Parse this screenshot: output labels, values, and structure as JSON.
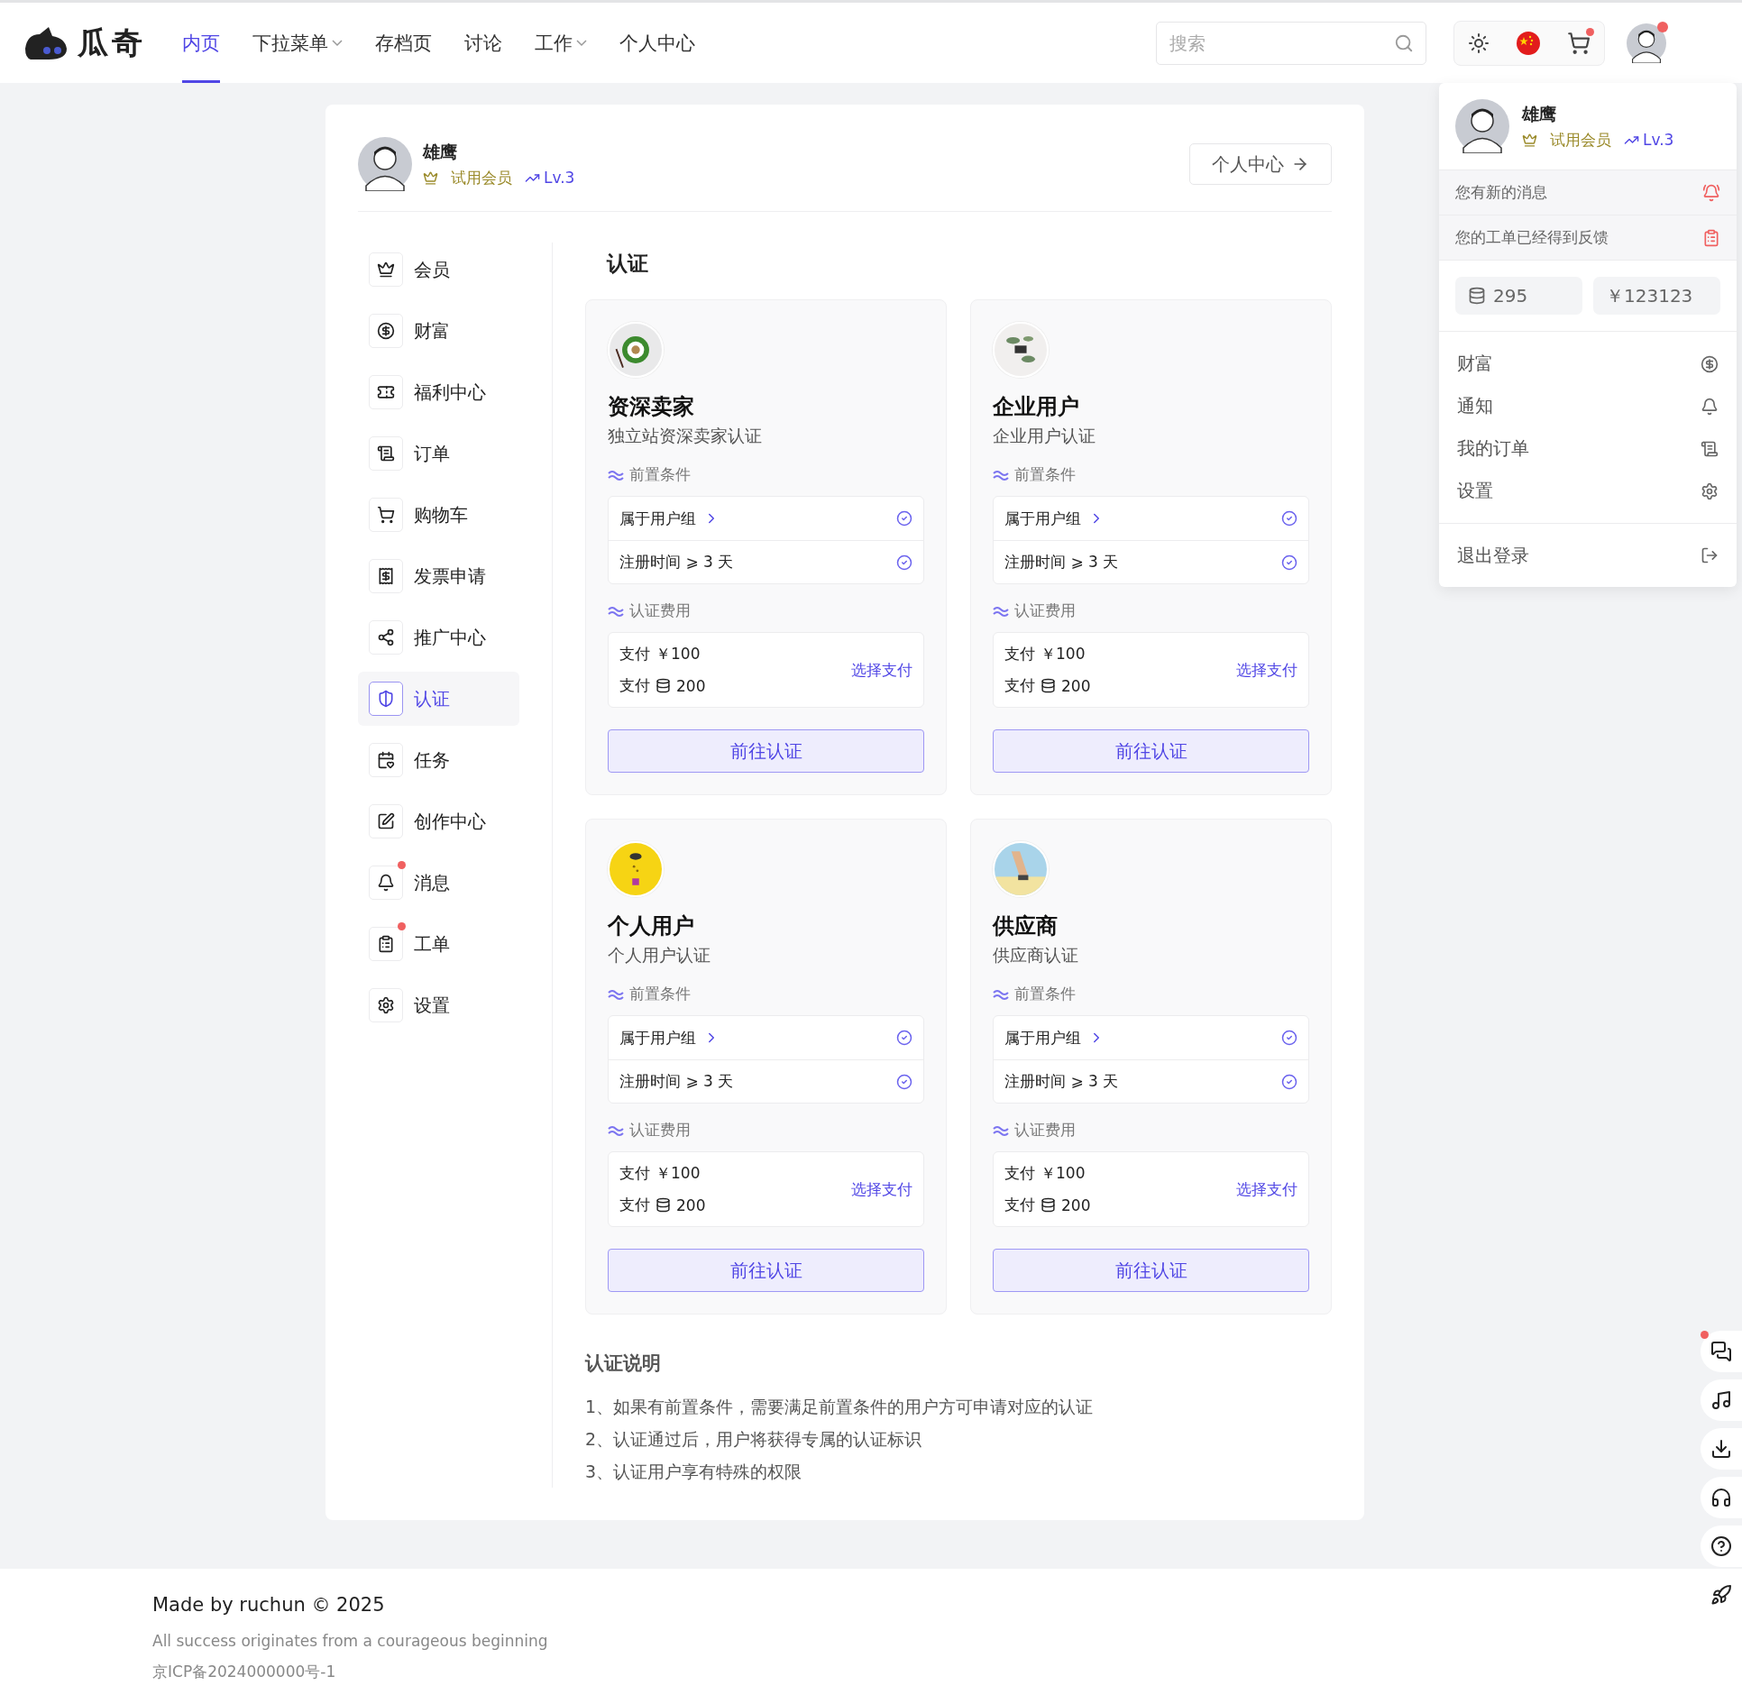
{
  "header": {
    "logo_text": "瓜奇",
    "nav": [
      {
        "label": "内页",
        "selected": true,
        "dropdown": false
      },
      {
        "label": "下拉菜单",
        "selected": false,
        "dropdown": true
      },
      {
        "label": "存档页",
        "selected": false,
        "dropdown": false
      },
      {
        "label": "讨论",
        "selected": false,
        "dropdown": false
      },
      {
        "label": "工作",
        "selected": false,
        "dropdown": true
      },
      {
        "label": "个人中心",
        "selected": false,
        "dropdown": false
      }
    ],
    "search": {
      "placeholder": "搜索"
    },
    "cart_badge": true,
    "avatar_badge": true
  },
  "profile": {
    "name": "雄鹰",
    "membership": "试用会员",
    "level": "Lv.3",
    "center_button": "个人中心"
  },
  "sidebar": [
    {
      "label": "会员",
      "selected": false,
      "badge": false
    },
    {
      "label": "财富",
      "selected": false,
      "badge": false
    },
    {
      "label": "福利中心",
      "selected": false,
      "badge": false
    },
    {
      "label": "订单",
      "selected": false,
      "badge": false
    },
    {
      "label": "购物车",
      "selected": false,
      "badge": false
    },
    {
      "label": "发票申请",
      "selected": false,
      "badge": false
    },
    {
      "label": "推广中心",
      "selected": false,
      "badge": false
    },
    {
      "label": "认证",
      "selected": true,
      "badge": false
    },
    {
      "label": "任务",
      "selected": false,
      "badge": false
    },
    {
      "label": "创作中心",
      "selected": false,
      "badge": false
    },
    {
      "label": "消息",
      "selected": false,
      "badge": true
    },
    {
      "label": "工单",
      "selected": false,
      "badge": true
    },
    {
      "label": "设置",
      "selected": false,
      "badge": false
    }
  ],
  "section_title": "认证",
  "cards": [
    {
      "title": "资深卖家",
      "subtitle": "独立站资深卖家认证",
      "prereq_label": "前置条件",
      "conditions": [
        {
          "text": "属于用户组",
          "link": true,
          "met": true
        },
        {
          "text": "注册时间 ⩾ 3 天",
          "link": false,
          "met": true
        }
      ],
      "fee_label": "认证费用",
      "fees": [
        {
          "label": "支付",
          "amount": "￥100",
          "kind": "cash"
        },
        {
          "label": "支付",
          "amount": "200",
          "kind": "coin"
        }
      ],
      "pay_link": "选择支付",
      "button": "前往认证"
    },
    {
      "title": "企业用户",
      "subtitle": "企业用户认证",
      "prereq_label": "前置条件",
      "conditions": [
        {
          "text": "属于用户组",
          "link": true,
          "met": true
        },
        {
          "text": "注册时间 ⩾ 3 天",
          "link": false,
          "met": true
        }
      ],
      "fee_label": "认证费用",
      "fees": [
        {
          "label": "支付",
          "amount": "￥100",
          "kind": "cash"
        },
        {
          "label": "支付",
          "amount": "200",
          "kind": "coin"
        }
      ],
      "pay_link": "选择支付",
      "button": "前往认证"
    },
    {
      "title": "个人用户",
      "subtitle": "个人用户认证",
      "prereq_label": "前置条件",
      "conditions": [
        {
          "text": "属于用户组",
          "link": true,
          "met": true
        },
        {
          "text": "注册时间 ⩾ 3 天",
          "link": false,
          "met": true
        }
      ],
      "fee_label": "认证费用",
      "fees": [
        {
          "label": "支付",
          "amount": "￥100",
          "kind": "cash"
        },
        {
          "label": "支付",
          "amount": "200",
          "kind": "coin"
        }
      ],
      "pay_link": "选择支付",
      "button": "前往认证"
    },
    {
      "title": "供应商",
      "subtitle": "供应商认证",
      "prereq_label": "前置条件",
      "conditions": [
        {
          "text": "属于用户组",
          "link": true,
          "met": true
        },
        {
          "text": "注册时间 ⩾ 3 天",
          "link": false,
          "met": true
        }
      ],
      "fee_label": "认证费用",
      "fees": [
        {
          "label": "支付",
          "amount": "￥100",
          "kind": "cash"
        },
        {
          "label": "支付",
          "amount": "200",
          "kind": "coin"
        }
      ],
      "pay_link": "选择支付",
      "button": "前往认证"
    }
  ],
  "notes": {
    "title": "认证说明",
    "items": [
      "1、如果有前置条件，需要满足前置条件的用户方可申请对应的认证",
      "2、认证通过后，用户将获得专属的认证标识",
      "3、认证用户享有特殊的权限"
    ]
  },
  "dropdown": {
    "name": "雄鹰",
    "membership": "试用会员",
    "level": "Lv.3",
    "notifications": [
      "您有新的消息",
      "您的工单已经得到反馈"
    ],
    "coins": "295",
    "balance": "￥123123",
    "menu": [
      "财富",
      "通知",
      "我的订单",
      "设置"
    ],
    "logout": "退出登录"
  },
  "tools": [
    {
      "badge": true
    },
    {
      "badge": false
    },
    {
      "badge": false
    },
    {
      "badge": false
    },
    {
      "badge": false
    },
    {
      "badge": false
    }
  ],
  "footer": {
    "credit": "Made by ruchun © 2025",
    "motto": "All success originates from a courageous beginning",
    "icp": "京ICP备2024000000号-1"
  }
}
